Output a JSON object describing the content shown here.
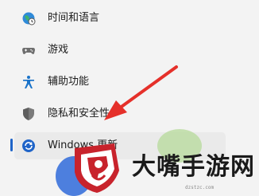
{
  "nav": {
    "items": [
      {
        "label": "时间和语言",
        "icon": "globe-clock-icon"
      },
      {
        "label": "游戏",
        "icon": "gamepad-icon"
      },
      {
        "label": "辅助功能",
        "icon": "accessibility-icon"
      },
      {
        "label": "隐私和安全性",
        "icon": "shield-icon"
      },
      {
        "label": "Windows 更新",
        "icon": "windows-update-icon"
      }
    ],
    "selected_index": 4
  },
  "watermark": {
    "brand": "大嘴手游网",
    "url": "dzstzc.com"
  },
  "colors": {
    "background": "#f3f3f3",
    "accent": "#1f64c8",
    "arrow": "#e5302a",
    "logo_red": "#c8232c"
  }
}
